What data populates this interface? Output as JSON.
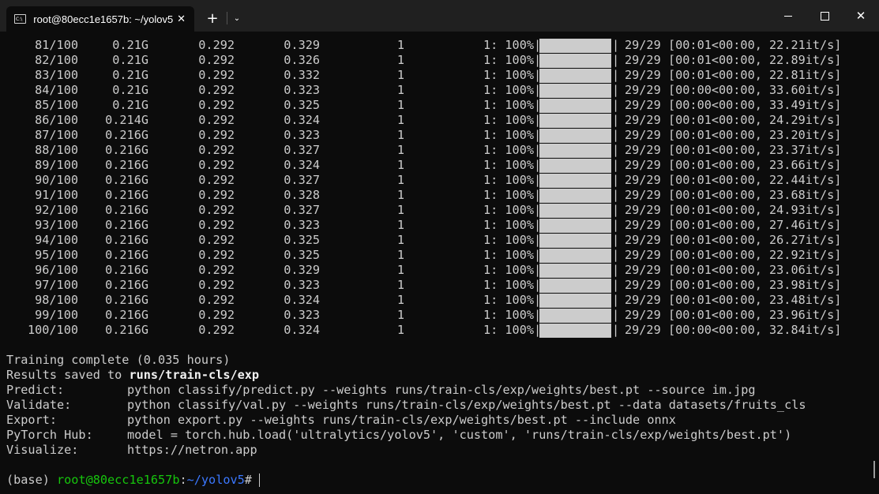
{
  "window": {
    "tab_title": "root@80ecc1e1657b: ~/yolov5",
    "tab_icon_text": "C:\\",
    "new_tab_glyph": "+",
    "dropdown_glyph": "⌄",
    "close_glyph": "✕"
  },
  "training_rows": [
    {
      "epoch": "81/100",
      "gpu_mem": "0.21G",
      "train_loss": "0.292",
      "test_loss": "0.329",
      "top1": "1",
      "top5": "1: 100%",
      "progress": "29/29",
      "timing": "[00:01<00:00, 22.21it/s]"
    },
    {
      "epoch": "82/100",
      "gpu_mem": "0.21G",
      "train_loss": "0.292",
      "test_loss": "0.326",
      "top1": "1",
      "top5": "1: 100%",
      "progress": "29/29",
      "timing": "[00:01<00:00, 22.89it/s]"
    },
    {
      "epoch": "83/100",
      "gpu_mem": "0.21G",
      "train_loss": "0.292",
      "test_loss": "0.332",
      "top1": "1",
      "top5": "1: 100%",
      "progress": "29/29",
      "timing": "[00:01<00:00, 22.81it/s]"
    },
    {
      "epoch": "84/100",
      "gpu_mem": "0.21G",
      "train_loss": "0.292",
      "test_loss": "0.323",
      "top1": "1",
      "top5": "1: 100%",
      "progress": "29/29",
      "timing": "[00:00<00:00, 33.60it/s]"
    },
    {
      "epoch": "85/100",
      "gpu_mem": "0.21G",
      "train_loss": "0.292",
      "test_loss": "0.325",
      "top1": "1",
      "top5": "1: 100%",
      "progress": "29/29",
      "timing": "[00:00<00:00, 33.49it/s]"
    },
    {
      "epoch": "86/100",
      "gpu_mem": "0.214G",
      "train_loss": "0.292",
      "test_loss": "0.324",
      "top1": "1",
      "top5": "1: 100%",
      "progress": "29/29",
      "timing": "[00:01<00:00, 24.29it/s]"
    },
    {
      "epoch": "87/100",
      "gpu_mem": "0.216G",
      "train_loss": "0.292",
      "test_loss": "0.323",
      "top1": "1",
      "top5": "1: 100%",
      "progress": "29/29",
      "timing": "[00:01<00:00, 23.20it/s]"
    },
    {
      "epoch": "88/100",
      "gpu_mem": "0.216G",
      "train_loss": "0.292",
      "test_loss": "0.327",
      "top1": "1",
      "top5": "1: 100%",
      "progress": "29/29",
      "timing": "[00:01<00:00, 23.37it/s]"
    },
    {
      "epoch": "89/100",
      "gpu_mem": "0.216G",
      "train_loss": "0.292",
      "test_loss": "0.324",
      "top1": "1",
      "top5": "1: 100%",
      "progress": "29/29",
      "timing": "[00:01<00:00, 23.66it/s]"
    },
    {
      "epoch": "90/100",
      "gpu_mem": "0.216G",
      "train_loss": "0.292",
      "test_loss": "0.327",
      "top1": "1",
      "top5": "1: 100%",
      "progress": "29/29",
      "timing": "[00:01<00:00, 22.44it/s]"
    },
    {
      "epoch": "91/100",
      "gpu_mem": "0.216G",
      "train_loss": "0.292",
      "test_loss": "0.328",
      "top1": "1",
      "top5": "1: 100%",
      "progress": "29/29",
      "timing": "[00:01<00:00, 23.68it/s]"
    },
    {
      "epoch": "92/100",
      "gpu_mem": "0.216G",
      "train_loss": "0.292",
      "test_loss": "0.327",
      "top1": "1",
      "top5": "1: 100%",
      "progress": "29/29",
      "timing": "[00:01<00:00, 24.93it/s]"
    },
    {
      "epoch": "93/100",
      "gpu_mem": "0.216G",
      "train_loss": "0.292",
      "test_loss": "0.323",
      "top1": "1",
      "top5": "1: 100%",
      "progress": "29/29",
      "timing": "[00:01<00:00, 27.46it/s]"
    },
    {
      "epoch": "94/100",
      "gpu_mem": "0.216G",
      "train_loss": "0.292",
      "test_loss": "0.325",
      "top1": "1",
      "top5": "1: 100%",
      "progress": "29/29",
      "timing": "[00:01<00:00, 26.27it/s]"
    },
    {
      "epoch": "95/100",
      "gpu_mem": "0.216G",
      "train_loss": "0.292",
      "test_loss": "0.325",
      "top1": "1",
      "top5": "1: 100%",
      "progress": "29/29",
      "timing": "[00:01<00:00, 22.92it/s]"
    },
    {
      "epoch": "96/100",
      "gpu_mem": "0.216G",
      "train_loss": "0.292",
      "test_loss": "0.329",
      "top1": "1",
      "top5": "1: 100%",
      "progress": "29/29",
      "timing": "[00:01<00:00, 23.06it/s]"
    },
    {
      "epoch": "97/100",
      "gpu_mem": "0.216G",
      "train_loss": "0.292",
      "test_loss": "0.323",
      "top1": "1",
      "top5": "1: 100%",
      "progress": "29/29",
      "timing": "[00:01<00:00, 23.98it/s]"
    },
    {
      "epoch": "98/100",
      "gpu_mem": "0.216G",
      "train_loss": "0.292",
      "test_loss": "0.324",
      "top1": "1",
      "top5": "1: 100%",
      "progress": "29/29",
      "timing": "[00:01<00:00, 23.48it/s]"
    },
    {
      "epoch": "99/100",
      "gpu_mem": "0.216G",
      "train_loss": "0.292",
      "test_loss": "0.323",
      "top1": "1",
      "top5": "1: 100%",
      "progress": "29/29",
      "timing": "[00:01<00:00, 23.96it/s]"
    },
    {
      "epoch": "100/100",
      "gpu_mem": "0.216G",
      "train_loss": "0.292",
      "test_loss": "0.324",
      "top1": "1",
      "top5": "1: 100%",
      "progress": "29/29",
      "timing": "[00:00<00:00, 32.84it/s]"
    }
  ],
  "summary": {
    "complete": "Training complete (0.035 hours)",
    "saved_label": "Results saved to ",
    "saved_path": "runs/train-cls/exp",
    "commands": [
      {
        "label": "Predict:",
        "value": "python classify/predict.py --weights runs/train-cls/exp/weights/best.pt --source im.jpg"
      },
      {
        "label": "Validate:",
        "value": "python classify/val.py --weights runs/train-cls/exp/weights/best.pt --data datasets/fruits_cls"
      },
      {
        "label": "Export:",
        "value": "python export.py --weights runs/train-cls/exp/weights/best.pt --include onnx"
      },
      {
        "label": "PyTorch Hub:",
        "value": "model = torch.hub.load('ultralytics/yolov5', 'custom', 'runs/train-cls/exp/weights/best.pt')"
      },
      {
        "label": "Visualize:",
        "value": "https://netron.app"
      }
    ]
  },
  "prompt": {
    "env": "(base) ",
    "user_host": "root@80ecc1e1657b",
    "colon": ":",
    "path": "~/yolov5",
    "symbol": "# "
  },
  "colors": {
    "background": "#0c0c0c",
    "text": "#cccccc",
    "prompt_user": "#16c60c",
    "prompt_path": "#3b78ff"
  }
}
